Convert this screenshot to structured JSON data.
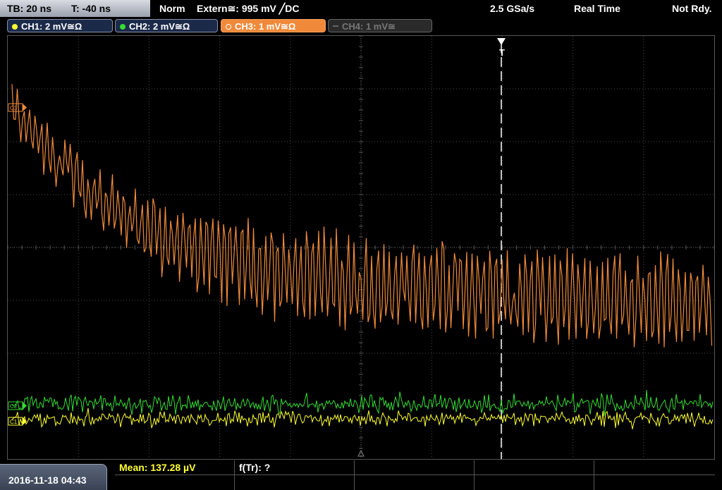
{
  "status": {
    "timebase": "TB: 20 ns",
    "trigger_offset": "T: -40 ns",
    "mode": "Norm",
    "trigger_source": "Extern≅: 995 mV ╱DC",
    "sample_rate": "2.5 GSa/s",
    "acq_mode": "Real Time",
    "state": "Not Rdy."
  },
  "channels": [
    {
      "label": "CH1: 2 mV≅Ω",
      "color": "#ffff33",
      "active": true
    },
    {
      "label": "CH2: 2 mV≅Ω",
      "color": "#33dd33",
      "active": true
    },
    {
      "label": "CH3: 1 mV≅Ω",
      "color": "#f08a3a",
      "active": true,
      "selected": true
    },
    {
      "label": "CH4: 1 mV≅",
      "color": "#777777",
      "active": false
    }
  ],
  "markers": {
    "ch3": "C3",
    "ch2": "C2",
    "ch1": "C1",
    "trigger": "T"
  },
  "measurement": {
    "mean": "Mean: 137.28 µV",
    "freq": "f(Tr): ?"
  },
  "datetime": "2016-11-18 04:43",
  "colors": {
    "ch1": "#ffff33",
    "ch2": "#33dd33",
    "ch3": "#f08a3a",
    "grid": "#555555",
    "trigger_line": "#ffffff"
  }
}
